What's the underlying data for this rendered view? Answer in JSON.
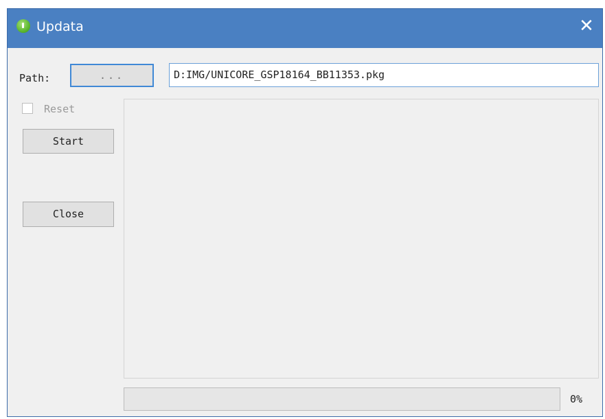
{
  "window": {
    "title": "Updata",
    "close_glyph": "✕",
    "icon": "green-circle-app-icon",
    "titlebar_color": "#4a80c2"
  },
  "path_row": {
    "label": "Path:",
    "browse_label": "...",
    "value": "D:IMG/UNICORE_GSP18164_BB11353.pkg"
  },
  "controls": {
    "reset_label": "Reset",
    "reset_checked": false,
    "start_label": "Start",
    "close_label": "Close"
  },
  "log": {
    "lines": []
  },
  "progress": {
    "value": 0,
    "text": "0%"
  }
}
